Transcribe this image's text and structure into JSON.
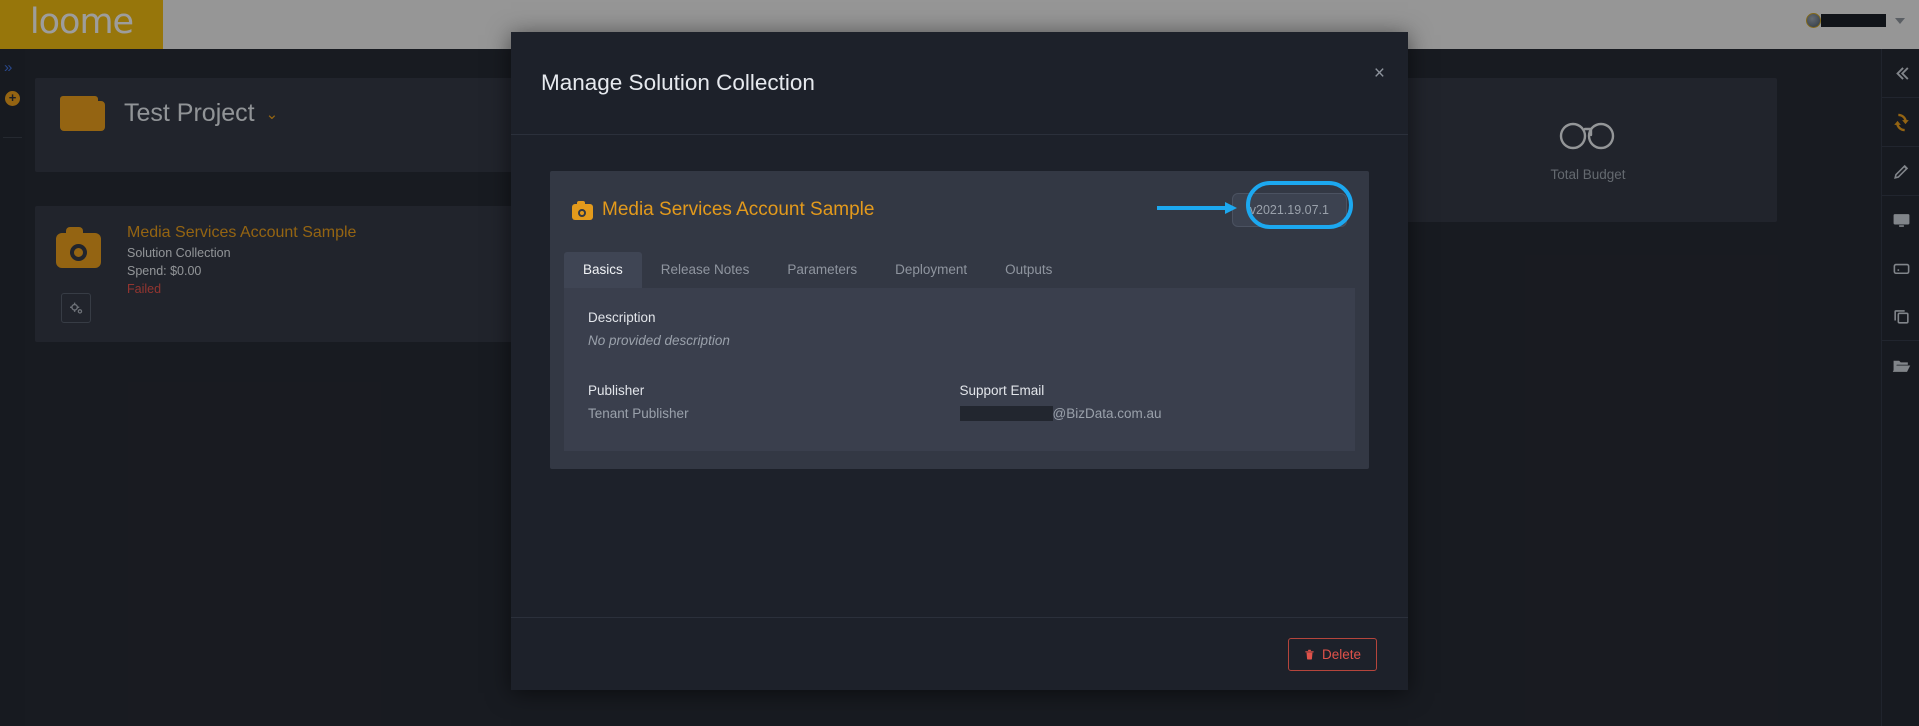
{
  "topbar": {
    "logo_text": "loome",
    "user_name_redacted": "",
    "avatar_icon": "user-avatar-icon",
    "caret_icon": "chevron-down-icon"
  },
  "left_rail": {
    "expand_icon": "double-chevron-right-icon",
    "add_icon": "plus-circle-icon"
  },
  "right_rail": {
    "items": [
      {
        "name": "collapse-panel",
        "icon": "double-chevron-left-icon"
      },
      {
        "name": "refresh",
        "icon": "refresh-icon"
      },
      {
        "name": "edit",
        "icon": "pencil-icon"
      },
      {
        "name": "monitor",
        "icon": "monitor-icon"
      },
      {
        "name": "storage",
        "icon": "hard-drive-icon"
      },
      {
        "name": "copy",
        "icon": "copy-icon"
      },
      {
        "name": "open-folder",
        "icon": "folder-open-icon"
      }
    ]
  },
  "project": {
    "name": "Test Project",
    "folder_icon": "folder-icon",
    "caret_icon": "double-chevron-down-icon"
  },
  "solution_card": {
    "icon": "camera-icon",
    "title": "Media Services Account Sample",
    "subtitle": "Solution Collection",
    "spend": "Spend: $0.00",
    "status": "Failed",
    "status_color": "#e0524a",
    "action_icon": "cogs-icon"
  },
  "budget_card": {
    "value_icon": "infinity-icon",
    "label": "Total Budget",
    "accent_color": "#e8b511"
  },
  "modal": {
    "title": "Manage Solution Collection",
    "close_label": "×",
    "panel": {
      "icon": "camera-icon",
      "title": "Media Services Account Sample",
      "version": "v2021.19.07.1",
      "annotation_color": "#1ca8f0"
    },
    "tabs": [
      {
        "label": "Basics",
        "active": true
      },
      {
        "label": "Release Notes",
        "active": false
      },
      {
        "label": "Parameters",
        "active": false
      },
      {
        "label": "Deployment",
        "active": false
      },
      {
        "label": "Outputs",
        "active": false
      }
    ],
    "basics": {
      "description_label": "Description",
      "description_value": "No provided description",
      "publisher_label": "Publisher",
      "publisher_value": "Tenant Publisher",
      "support_email_label": "Support Email",
      "support_email_redacted": "",
      "support_email_domain": "@BizData.com.au"
    },
    "footer": {
      "delete_label": "Delete",
      "delete_icon": "trash-icon"
    }
  }
}
